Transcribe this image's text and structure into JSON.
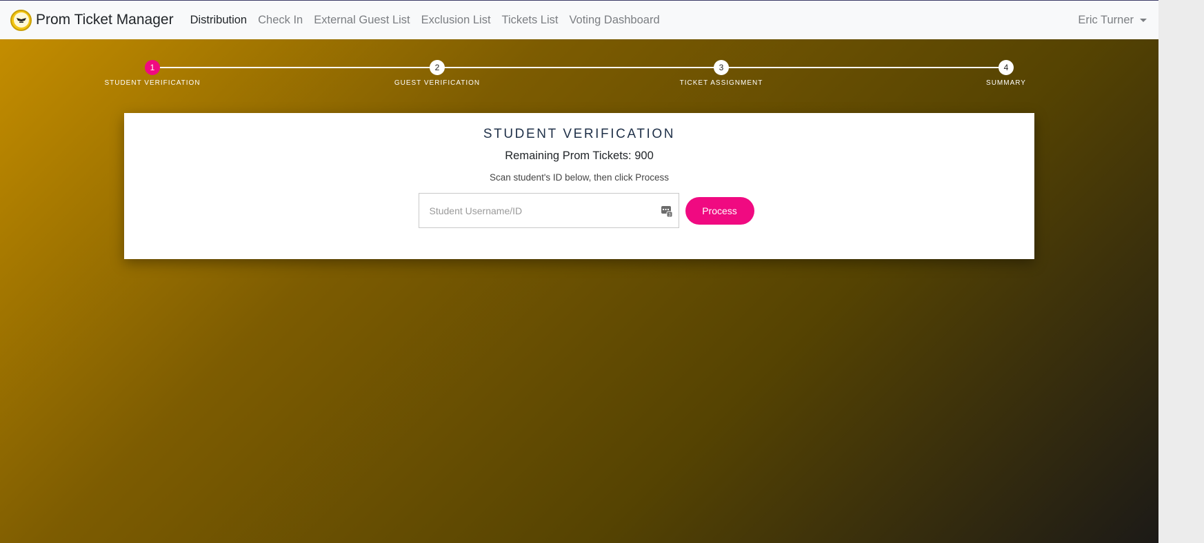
{
  "app": {
    "title": "Prom Ticket Manager"
  },
  "nav": {
    "items": [
      {
        "label": "Distribution",
        "active": true
      },
      {
        "label": "Check In",
        "active": false
      },
      {
        "label": "External Guest List",
        "active": false
      },
      {
        "label": "Exclusion List",
        "active": false
      },
      {
        "label": "Tickets List",
        "active": false
      },
      {
        "label": "Voting Dashboard",
        "active": false
      }
    ],
    "user": "Eric Turner"
  },
  "stepper": {
    "steps": [
      {
        "number": "1",
        "label": "STUDENT VERIFICATION",
        "active": true
      },
      {
        "number": "2",
        "label": "GUEST VERIFICATION",
        "active": false
      },
      {
        "number": "3",
        "label": "TICKET ASSIGNMENT",
        "active": false
      },
      {
        "number": "4",
        "label": "SUMMARY",
        "active": false
      }
    ]
  },
  "card": {
    "title": "STUDENT VERIFICATION",
    "remaining": "Remaining Prom Tickets: 900",
    "instruction": "Scan student's ID below, then click Process",
    "input_placeholder": "Student Username/ID",
    "input_value": "",
    "process_label": "Process"
  },
  "icons": {
    "logo": "prom-logo-icon",
    "id_card": "id-card-icon",
    "caret": "caret-down-icon"
  },
  "colors": {
    "accent": "#f00a81",
    "title": "#1f3048",
    "navbar": "#f8f9fa",
    "gradient_start": "#c48d00",
    "gradient_end": "#1c1a17"
  }
}
